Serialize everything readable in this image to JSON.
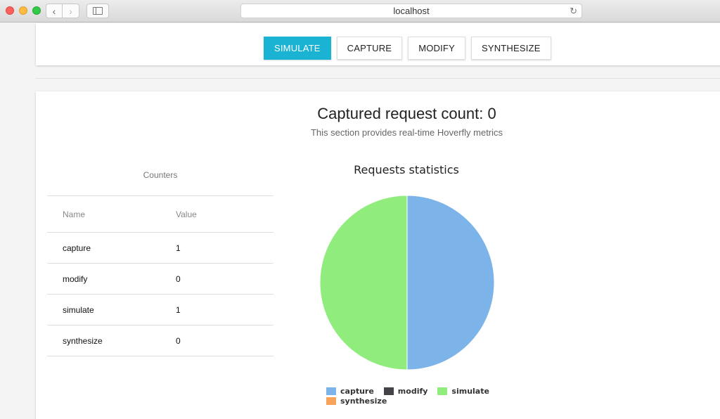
{
  "browser": {
    "address": "localhost",
    "icons": {
      "back": "chevron-left-icon",
      "forward": "chevron-right-icon",
      "sidebar": "sidebar-icon",
      "reload": "reload-icon"
    }
  },
  "modes": {
    "active": "SIMULATE",
    "buttons": [
      {
        "label": "SIMULATE"
      },
      {
        "label": "CAPTURE"
      },
      {
        "label": "MODIFY"
      },
      {
        "label": "SYNTHESIZE"
      }
    ]
  },
  "metrics": {
    "title": "Captured request count: 0",
    "subtitle": "This section provides real-time Hoverfly metrics"
  },
  "counters": {
    "caption": "Counters",
    "headers": [
      "Name",
      "Value"
    ],
    "rows": [
      {
        "name": "capture",
        "value": "1"
      },
      {
        "name": "modify",
        "value": "0"
      },
      {
        "name": "simulate",
        "value": "1"
      },
      {
        "name": "synthesize",
        "value": "0"
      }
    ]
  },
  "chart_data": {
    "type": "pie",
    "title": "Requests statistics",
    "categories": [
      "capture",
      "modify",
      "simulate",
      "synthesize"
    ],
    "values": [
      1,
      0,
      1,
      0
    ],
    "colors": [
      "#7cb4ea",
      "#434348",
      "#90ed7d",
      "#f7a35c"
    ],
    "legend": "bottom"
  },
  "colors": {
    "accent": "#1ab3d3"
  }
}
